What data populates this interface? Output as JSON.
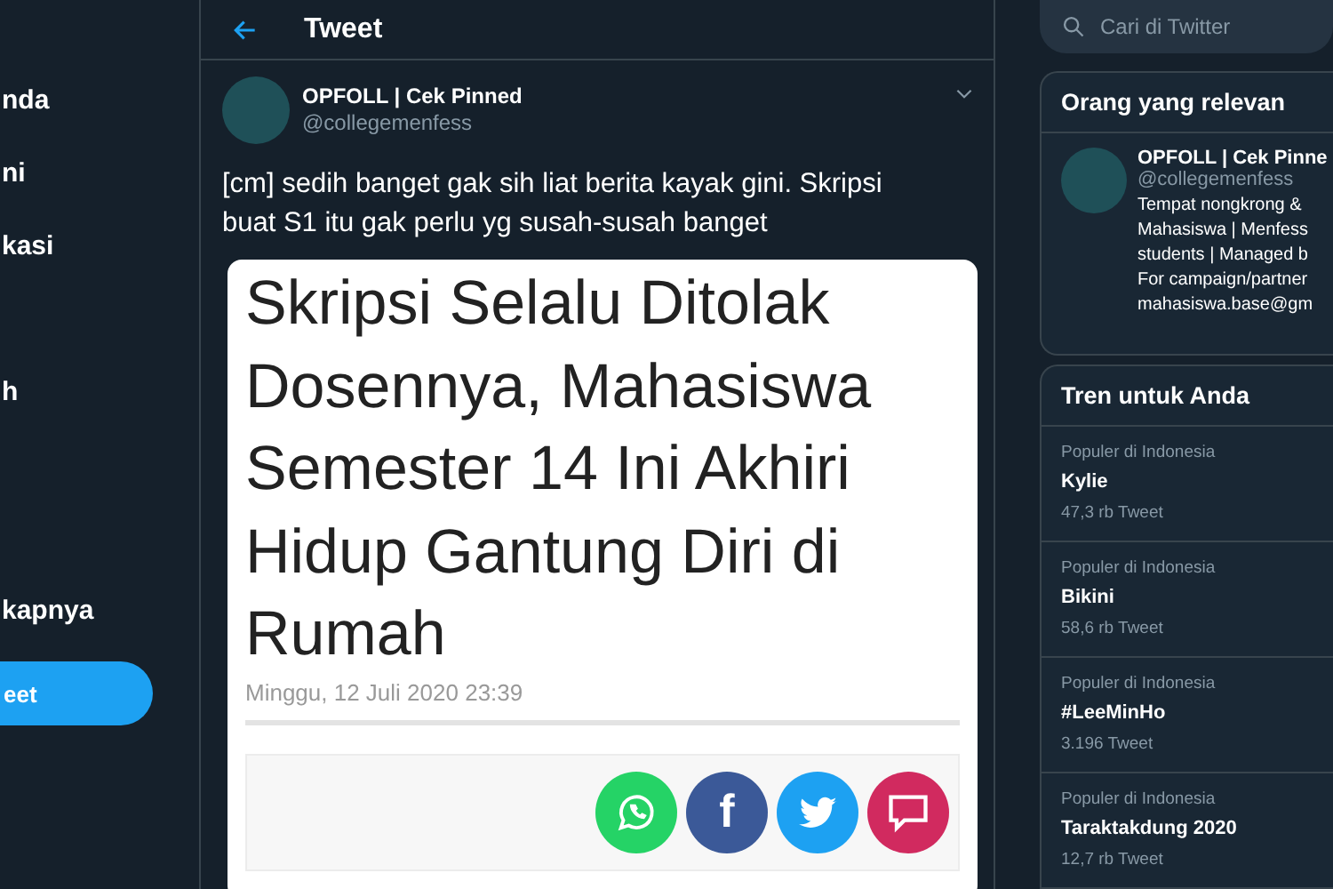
{
  "sidebar": {
    "items": [
      {
        "label": "nda"
      },
      {
        "label": "ni"
      },
      {
        "label": "kasi"
      },
      {
        "label": "h"
      },
      {
        "label": "kapnya"
      }
    ],
    "tweet_button": "eet"
  },
  "header": {
    "title": "Tweet"
  },
  "tweet": {
    "name": "OPFOLL | Cek Pinned",
    "handle": "@collegemenfess",
    "text": "[cm] sedih banget gak sih liat berita kayak gini. Skripsi buat S1 itu gak perlu  yg susah-susah banget",
    "image": {
      "headline": "Skripsi Selalu Ditolak Dosennya, Mahasiswa Semester 14 Ini Akhiri Hidup Gantung Diri di Rumah",
      "date": "Minggu, 12 Juli 2020 23:39",
      "share_buttons": [
        {
          "kind": "whatsapp",
          "color": "#25d366"
        },
        {
          "kind": "facebook",
          "label": "f",
          "color": "#3b5998"
        },
        {
          "kind": "twitter",
          "color": "#1da1f2"
        },
        {
          "kind": "comment",
          "color": "#d12a5f"
        }
      ]
    }
  },
  "search": {
    "placeholder": "Cari di Twitter"
  },
  "relevant": {
    "title": "Orang yang relevan",
    "person": {
      "name": "OPFOLL | Cek Pinne",
      "handle": "@collegemenfess",
      "bio": [
        "Tempat nongkrong &",
        "Mahasiswa | Menfess",
        "students | Managed b",
        "For campaign/partner",
        "mahasiswa.base@gm"
      ]
    }
  },
  "trends": {
    "title": "Tren untuk Anda",
    "items": [
      {
        "context": "Populer di Indonesia",
        "name": "Kylie",
        "count": "47,3 rb Tweet"
      },
      {
        "context": "Populer di Indonesia",
        "name": "Bikini",
        "count": "58,6 rb Tweet"
      },
      {
        "context": "Populer di Indonesia",
        "name": "#LeeMinHo",
        "count": "3.196 Tweet"
      },
      {
        "context": "Populer di Indonesia",
        "name": "Taraktakdung 2020",
        "count": "12,7 rb Tweet"
      }
    ]
  }
}
